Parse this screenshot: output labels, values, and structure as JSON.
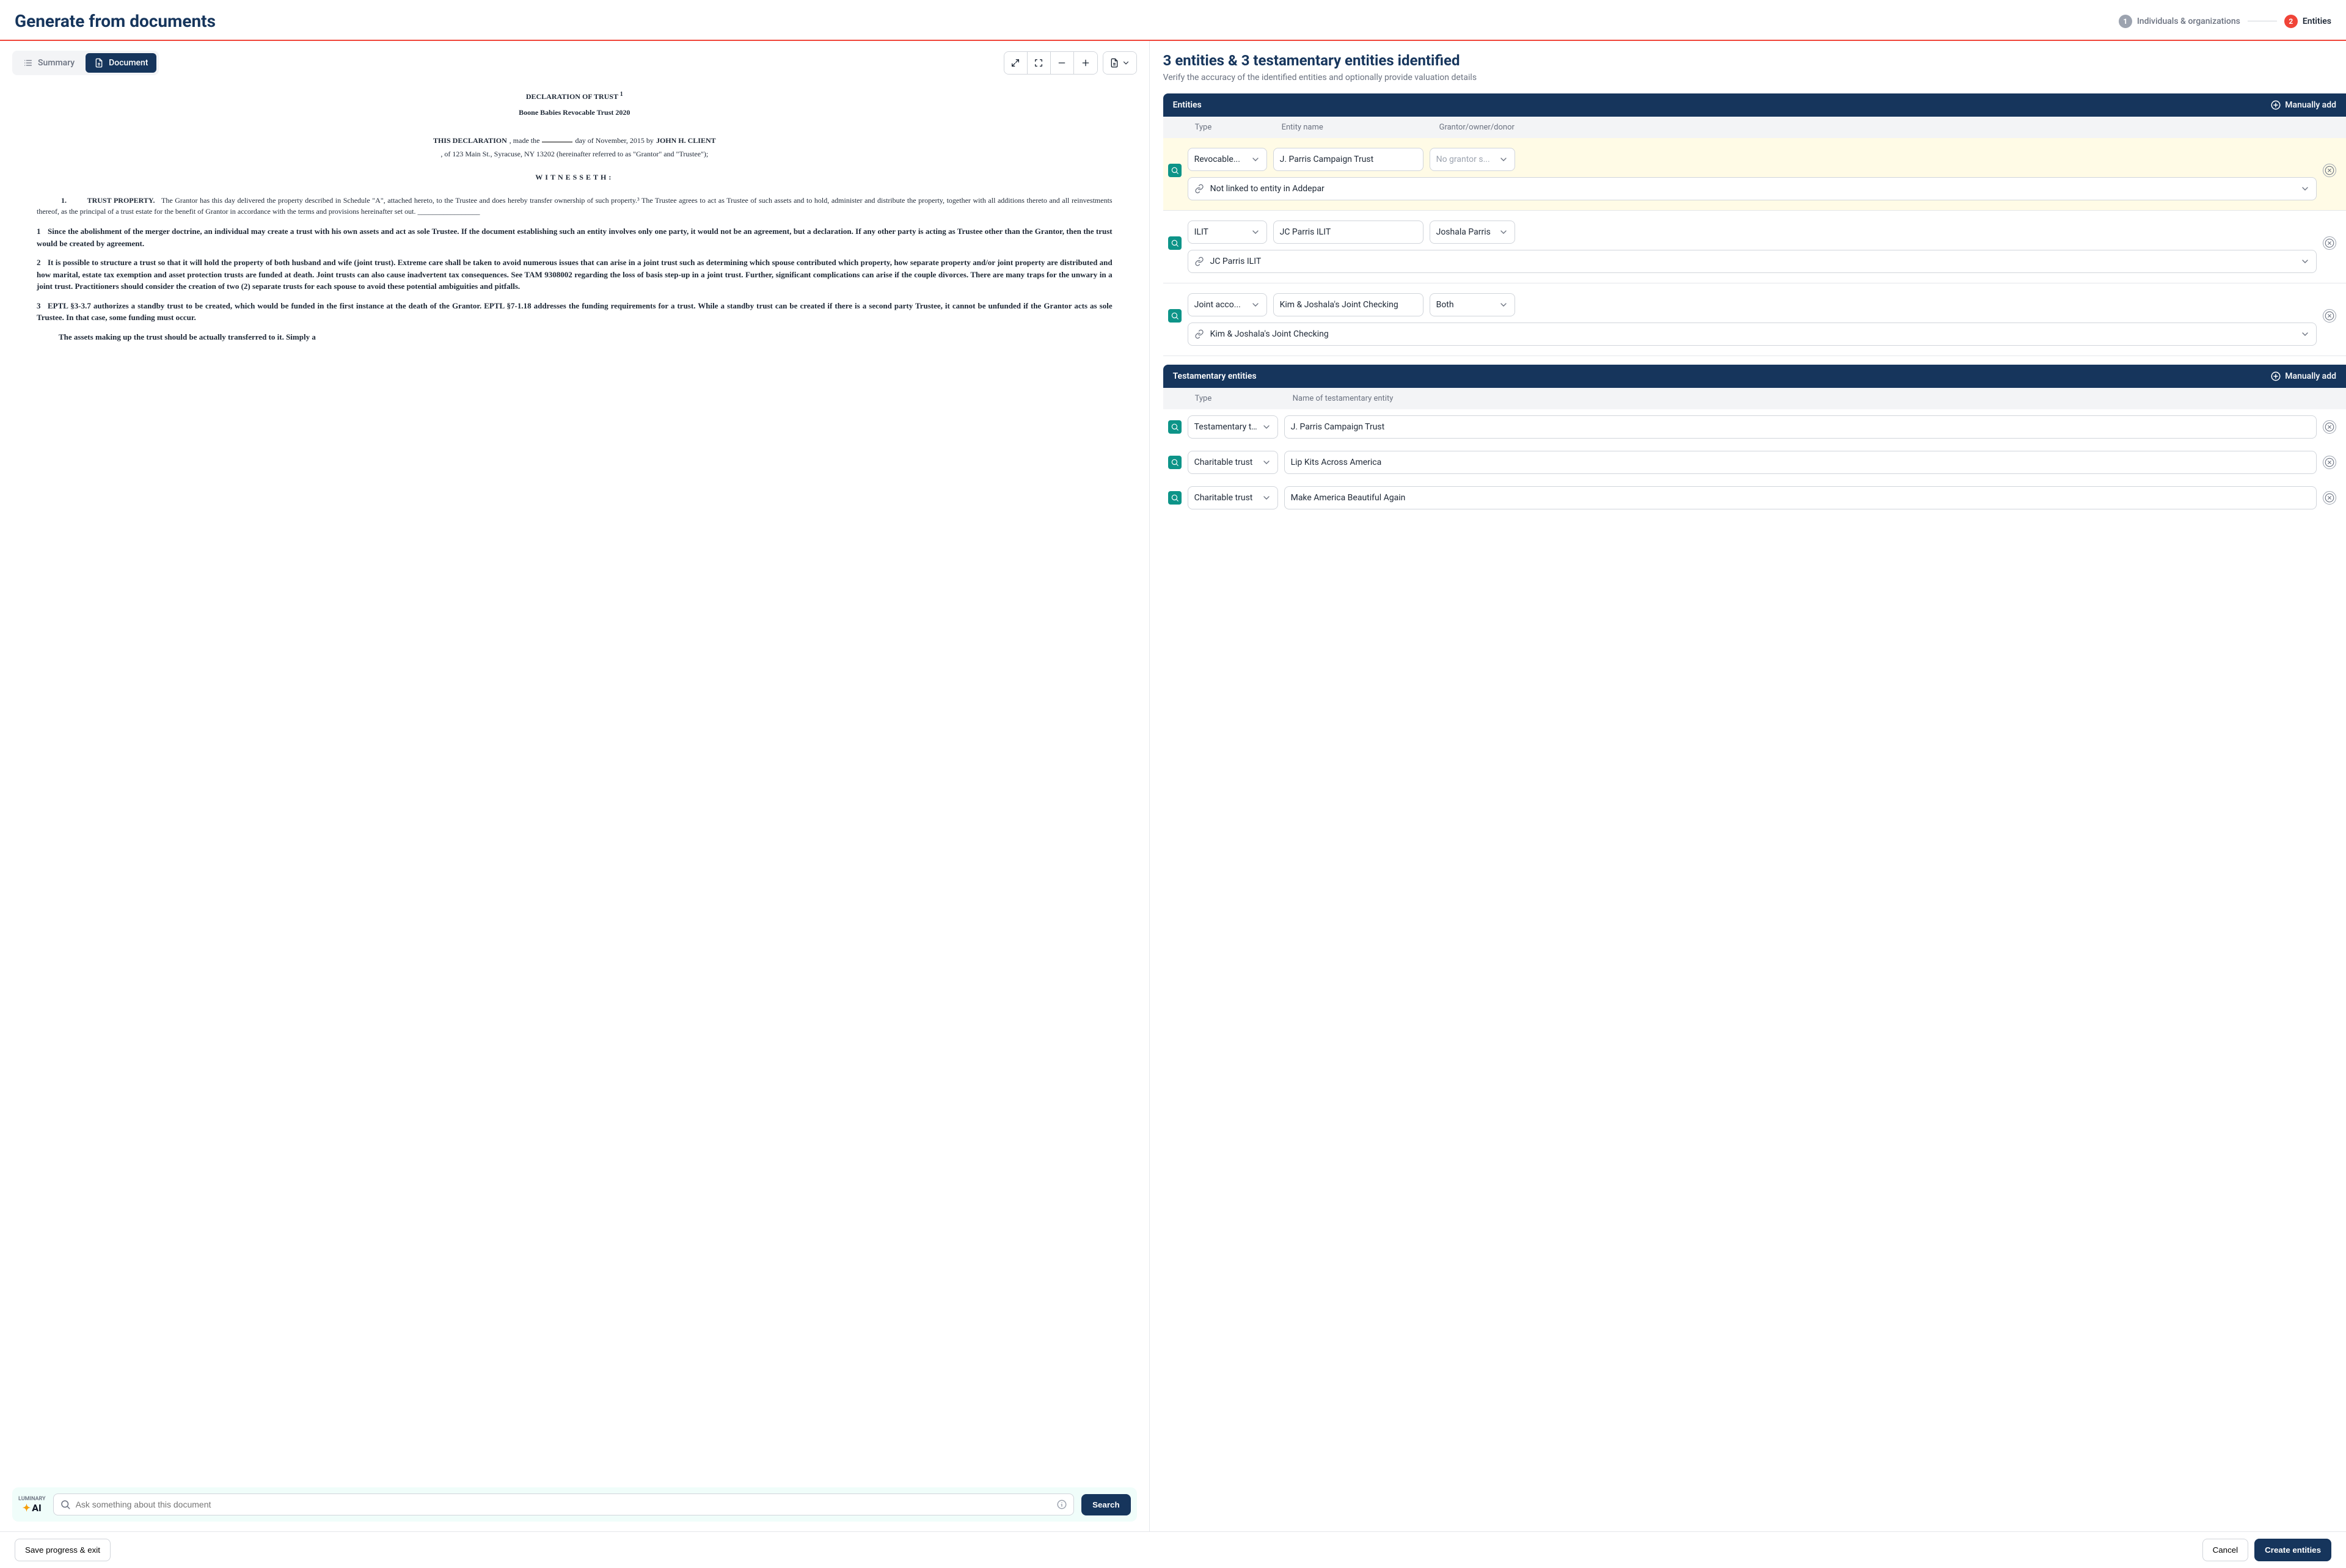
{
  "header": {
    "title": "Generate from documents",
    "steps": [
      {
        "num": "1",
        "label": "Individuals & organizations"
      },
      {
        "num": "2",
        "label": "Entities"
      }
    ]
  },
  "left": {
    "tabs": {
      "summary": "Summary",
      "document": "Document"
    },
    "doc": {
      "title": "DECLARATION OF TRUST",
      "title_sup": "1",
      "subtitle": "Boone Babies Revocable Trust 2020",
      "decl_prefix": "THIS DECLARATION",
      "decl_mid": ", made the",
      "decl_suffix": "day of November, 2015 by",
      "decl_name": "JOHN H. CLIENT",
      "decl_addr": ", of 123 Main St., Syracuse, NY 13202 (hereinafter referred to as \"Grantor\" and \"Trustee\");",
      "witness": "WITNESSETH:",
      "prop_num": "1.",
      "prop_head": "TRUST PROPERTY.",
      "prop_body": "The Grantor has this day delivered the property described in Schedule \"A\", attached hereto, to the Trustee and does hereby transfer ownership of such property.³ The Trustee agrees to act as Trustee of such assets and to hold, administer and distribute the property, together with all additions thereto and all reinvestments thereof, as the principal of a trust estate for the benefit of Grantor in accordance with the terms and provisions hereinafter set out. _________________",
      "paras": [
        {
          "n": "1",
          "t": "Since the abolishment of the merger doctrine, an individual may create a trust with his own assets and act as sole Trustee.   If the document establishing such an entity involves only one party, it would not be an agreement, but a declaration.   If any other party is acting as Trustee other than the Grantor, then the trust would be created by agreement."
        },
        {
          "n": "2",
          "t": "It is possible to structure a trust so that it will hold the property of both husband and wife (joint trust).   Extreme care shall be taken to avoid numerous issues that can arise in a joint trust such as determining which spouse contributed which property, how separate property and/or joint property are distributed and how marital, estate tax exemption and asset protection trusts are funded at death.   Joint trusts can also cause inadvertent tax consequences.   See TAM 9308002 regarding the loss of basis step-up in a joint trust. Further, significant complications can arise if the couple divorces. There are many traps for the unwary in a joint trust.   Practitioners should consider the creation of two (2) separate trusts for each spouse to avoid these potential ambiguities and pitfalls."
        },
        {
          "n": "3",
          "t": "EPTL §3-3.7 authorizes a standby trust to be created, which would be funded in the first instance at the death of the Grantor.   EPTL §7-1.18 addresses the funding requirements for a trust.   While a standby trust can be created if there is a second party Trustee, it cannot be unfunded if the Grantor acts as sole Trustee.   In that case, some funding must occur."
        }
      ],
      "tail": "The assets making up the trust should be actually transferred to it.   Simply a"
    },
    "ai": {
      "brand_top": "LUMINARY",
      "brand_bottom": "AI",
      "placeholder": "Ask something about this document",
      "search_label": "Search"
    }
  },
  "right": {
    "heading": "3 entities & 3 testamentary entities identified",
    "subhead": "Verify the accuracy of the identified entities and optionally provide valuation details",
    "entities_section": {
      "title": "Entities",
      "manually_add": "Manually add",
      "cols": {
        "type": "Type",
        "name": "Entity name",
        "grantor": "Grantor/owner/donor"
      },
      "rows": [
        {
          "type": "Revocable...",
          "name": "J. Parris Campaign Trust",
          "grantor": "No grantor s...",
          "grantor_placeholder": true,
          "link": "Not linked to entity in Addepar",
          "highlight": true
        },
        {
          "type": "ILIT",
          "name": "JC Parris ILIT",
          "grantor": "Joshala Parris",
          "link": "JC Parris ILIT"
        },
        {
          "type": "Joint acco...",
          "name": "Kim & Joshala's Joint Checking",
          "grantor": "Both",
          "link": "Kim & Joshala's Joint Checking"
        }
      ]
    },
    "testamentary_section": {
      "title": "Testamentary entities",
      "manually_add": "Manually add",
      "cols": {
        "type": "Type",
        "name": "Name of testamentary entity"
      },
      "rows": [
        {
          "type": "Testamentary tr...",
          "name": "J. Parris Campaign Trust"
        },
        {
          "type": "Charitable trust",
          "name": "Lip Kits Across America"
        },
        {
          "type": "Charitable trust",
          "name": "Make America Beautiful Again"
        }
      ]
    }
  },
  "footer": {
    "save": "Save progress & exit",
    "cancel": "Cancel",
    "create": "Create entities"
  }
}
